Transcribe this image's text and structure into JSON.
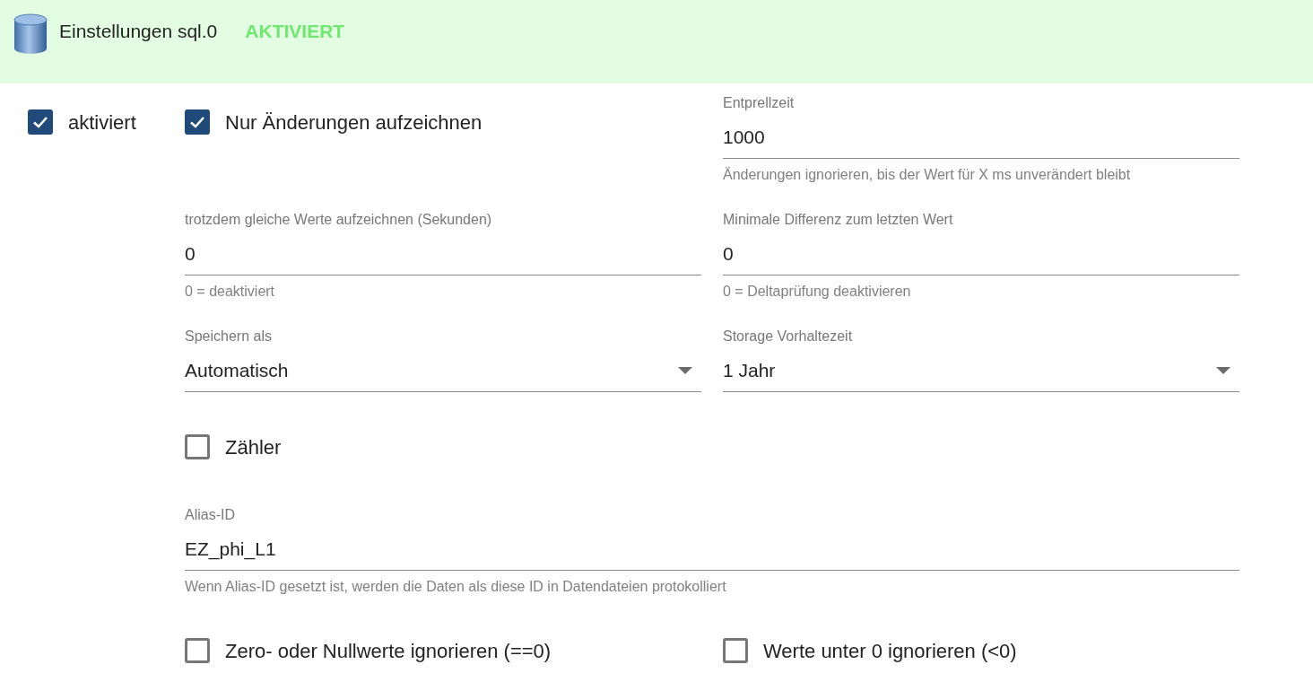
{
  "header": {
    "title": "Einstellungen sql.0",
    "status": "AKTIVIERT"
  },
  "enabled": {
    "label": "aktiviert",
    "checked": true
  },
  "items": [
    {
      "kind": "checkbox",
      "label": "Nur Änderungen aufzeichnen",
      "checked": true
    },
    {
      "kind": "text",
      "label": "Entprellzeit",
      "value": "1000",
      "helper": "Änderungen ignorieren, bis der Wert für X ms unverändert bleibt"
    },
    {
      "kind": "text",
      "label": "trotzdem gleiche Werte aufzeichnen (Sekunden)",
      "value": "0",
      "helper": "0 = deaktiviert"
    },
    {
      "kind": "text",
      "label": "Minimale Differenz zum letzten Wert",
      "value": "0",
      "helper": "0 = Deltaprüfung deaktivieren"
    },
    {
      "kind": "select",
      "label": "Speichern als",
      "value": "Automatisch"
    },
    {
      "kind": "select",
      "label": "Storage Vorhaltezeit",
      "value": "1 Jahr"
    },
    {
      "kind": "checkbox",
      "label": "Zähler",
      "checked": false
    },
    {
      "kind": "text",
      "label": "Alias-ID",
      "value": "EZ_phi_L1",
      "helper": "Wenn Alias-ID gesetzt ist, werden die Daten als diese ID in Datendateien protokolliert",
      "full_width": true
    },
    {
      "kind": "checkbox",
      "label": "Zero- oder Nullwerte ignorieren (==0)",
      "checked": false
    },
    {
      "kind": "checkbox",
      "label": "Werte unter 0 ignorieren (<0)",
      "checked": false
    }
  ]
}
